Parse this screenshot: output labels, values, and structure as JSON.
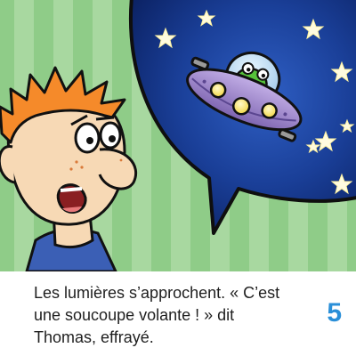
{
  "story": {
    "caption_lines": [
      "Les lumières s’approchent. « C’est",
      "une soucoupe volante ! » dit",
      "Thomas, effrayé."
    ],
    "page_number": "5"
  },
  "illustration": {
    "characters": [
      "boy-thomas",
      "green-alien-in-saucer"
    ],
    "colors": {
      "background_stripe_light": "#a8d8a0",
      "background_stripe_dark": "#8fcc88",
      "night_sky": "#14307a",
      "saucer": "#9b82c9",
      "alien": "#56c23a",
      "hair": "#f58a2a",
      "skin": "#f7d9b5",
      "page_number": "#2a8fd8"
    }
  }
}
